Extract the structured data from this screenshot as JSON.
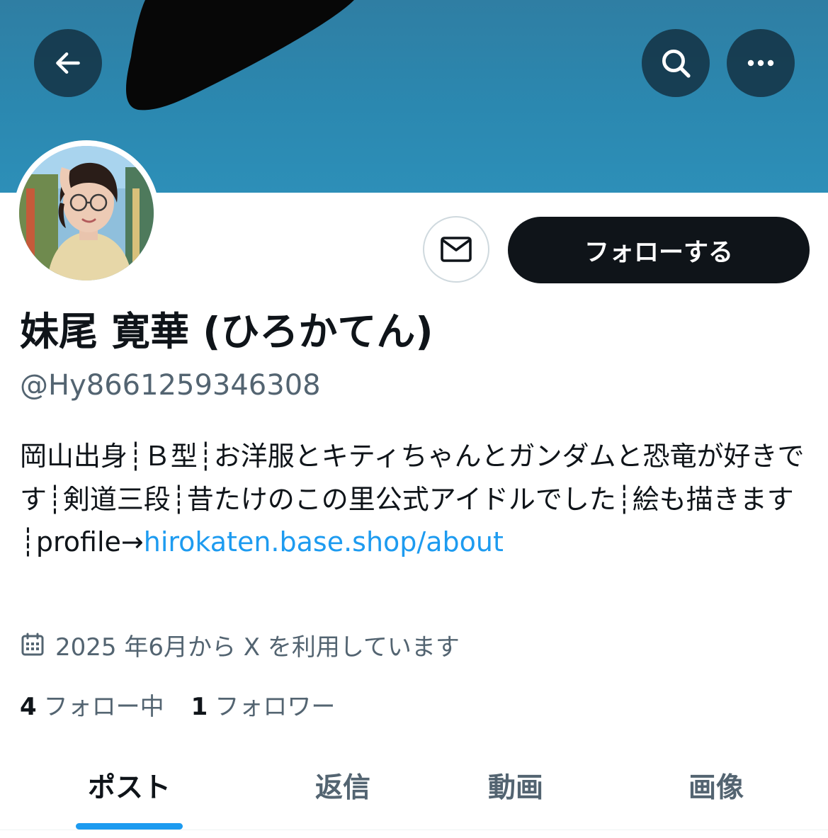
{
  "colors": {
    "accent": "#1d9bf0",
    "text_primary": "#0f1419",
    "text_secondary": "#536471",
    "banner": "#2d8ab2",
    "follow_button_bg": "#0f1419"
  },
  "header": {
    "back_icon": "arrow-left-icon",
    "search_icon": "search-icon",
    "more_icon": "more-horizontal-icon"
  },
  "profile": {
    "avatar_icon": "profile-photo",
    "display_name": "妹尾 寛華 (ひろかてん)",
    "handle": "@Hy8661259346308",
    "bio_text": "岡山出身┊Ｂ型┊お洋服とキティちゃんとガンダムと恐竜が好きです┊剣道三段┊昔たけのこの里公式アイドルでした┊絵も描きます┊profile→",
    "bio_link": "hirokaten.base.shop/about",
    "joined_icon": "calendar-icon",
    "joined_text": "2025 年6月から X を利用しています"
  },
  "actions": {
    "message_icon": "mail-icon",
    "follow_label": "フォローする"
  },
  "stats": {
    "following_count": "4",
    "following_label": "フォロー中",
    "followers_count": "1",
    "followers_label": "フォロワー"
  },
  "tabs": [
    {
      "label": "ポスト",
      "active": true
    },
    {
      "label": "返信",
      "active": false
    },
    {
      "label": "動画",
      "active": false
    },
    {
      "label": "画像",
      "active": false
    }
  ]
}
